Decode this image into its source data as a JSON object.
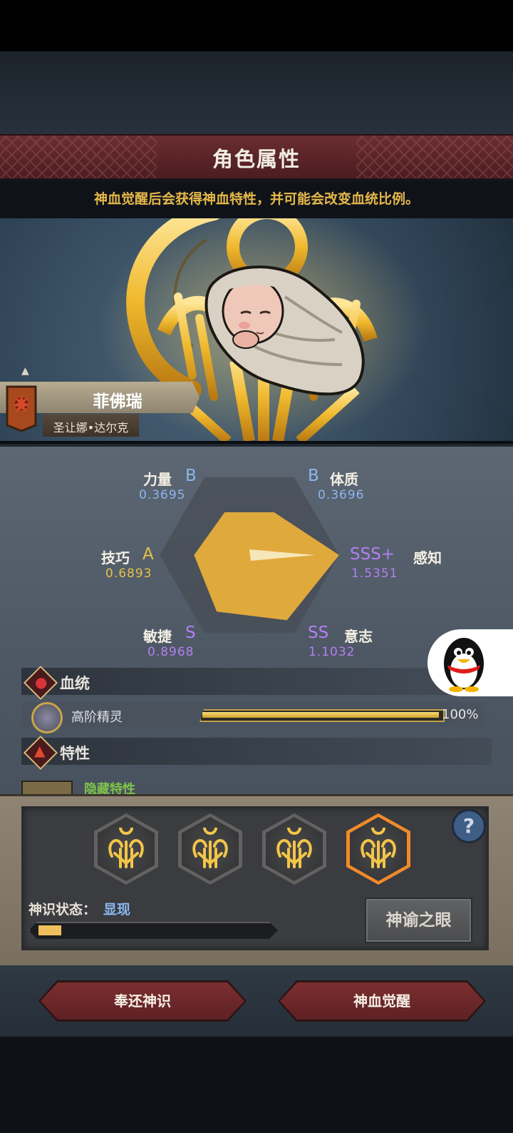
{
  "header": {
    "title": "角色属性",
    "subtitle": "神血觉醒后会获得神血特性，并可能会改变血统比例。"
  },
  "character": {
    "name": "菲佛瑞",
    "origin": "圣让娜•达尔克"
  },
  "stats": [
    {
      "key": "strength",
      "label": "力量",
      "grade": "B",
      "value": "0.3695"
    },
    {
      "key": "constitution",
      "label": "体质",
      "grade": "B",
      "value": "0.3696"
    },
    {
      "key": "skill",
      "label": "技巧",
      "grade": "A",
      "value": "0.6893"
    },
    {
      "key": "perception",
      "label": "感知",
      "grade": "SSS+",
      "value": "1.5351"
    },
    {
      "key": "agility",
      "label": "敏捷",
      "grade": "S",
      "value": "0.8968"
    },
    {
      "key": "will",
      "label": "意志",
      "grade": "SS",
      "value": "1.1032"
    }
  ],
  "radar_levels": {
    "strength": 0.3695,
    "constitution": 0.3696,
    "skill": 0.6893,
    "perception": 1.5351,
    "agility": 0.8968,
    "will": 1.1032
  },
  "bloodline": {
    "section_title": "血统",
    "name": "高阶精灵",
    "percent": "100%",
    "fraction": 1.0
  },
  "traits": {
    "section_title": "特性",
    "hidden_label": "隐藏特性"
  },
  "divine_sense": {
    "state_label": "神识状态：",
    "state_value": "显现",
    "progress": 0.1,
    "help_label": "?",
    "eye_button": "神谕之眼"
  },
  "actions": {
    "return_label": "奉还神识",
    "awaken_label": "神血觉醒"
  },
  "colors": {
    "gold": "#e6b84a",
    "grade_blue": "#8cb6ee",
    "grade_gold": "#e6c24a",
    "grade_purple": "#b57ff0",
    "accent_red": "#6a2d30"
  },
  "icons": {
    "help": "question-icon",
    "crest": "divine-crest-icon",
    "bloodline": "blood-drop-icon",
    "traits": "flame-icon",
    "qq": "qq-penguin-icon"
  }
}
